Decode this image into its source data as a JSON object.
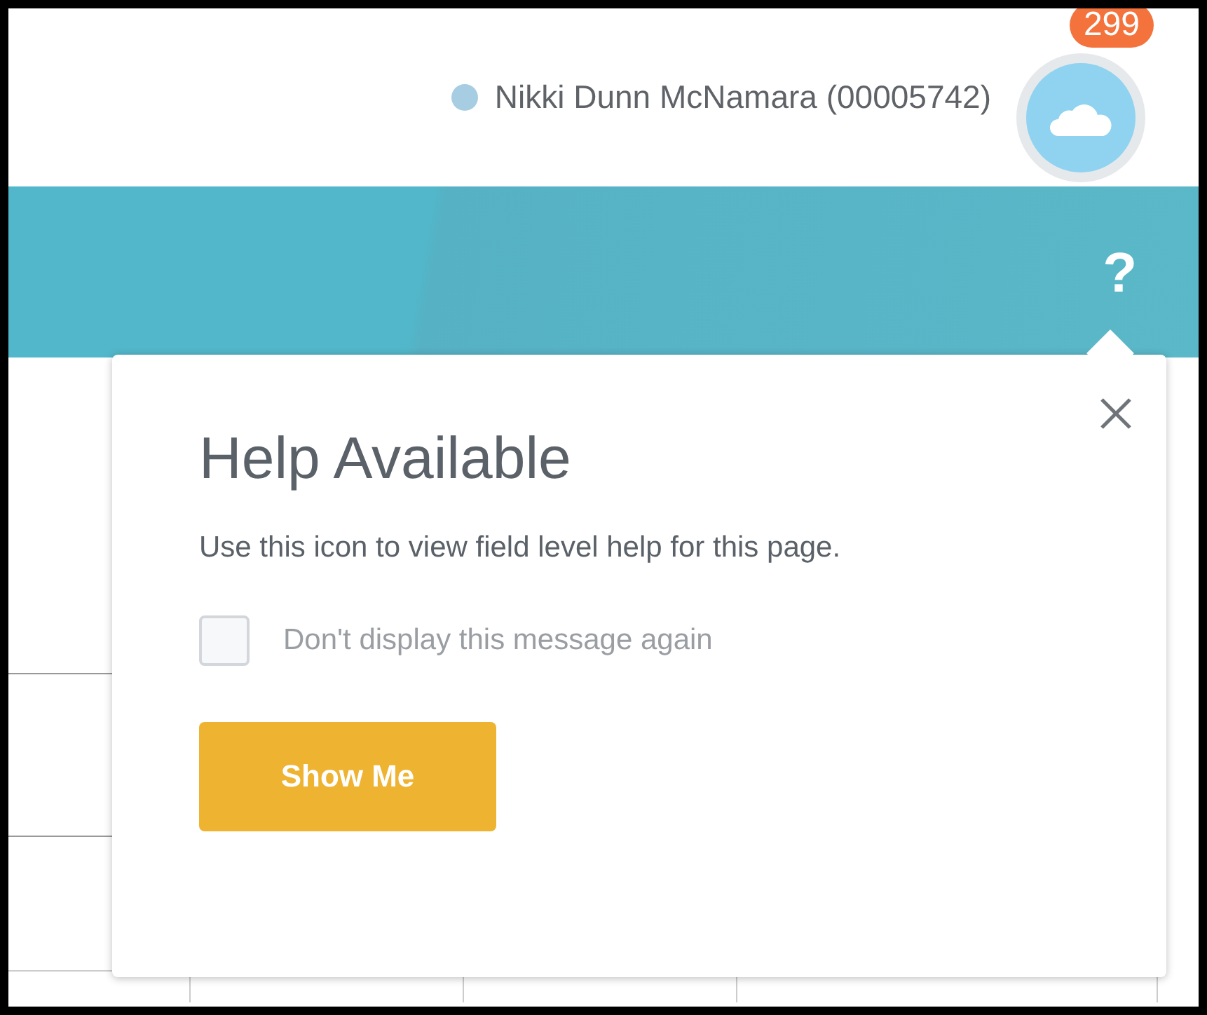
{
  "header": {
    "user": "Nikki Dunn McNamara (00005742)",
    "notifications": "299"
  },
  "banner": {
    "help": "?"
  },
  "popover": {
    "title": "Help Available",
    "message": "Use this icon to view field level help for this page.",
    "checkbox": {
      "label": "Don't display this message again",
      "checked": false
    },
    "button": "Show Me"
  }
}
